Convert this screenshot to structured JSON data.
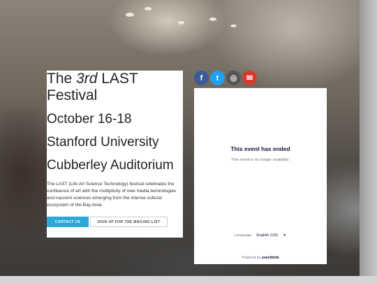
{
  "festival": {
    "title_prefix": "The ",
    "title_ordinal": "3rd",
    "title_suffix": " LAST",
    "title_line2": "Festival",
    "dates": "October 16-18",
    "venue_line1": "Stanford University",
    "venue_line2": "Cubberley Auditorium",
    "description": "The LAST (Life Art Science Technology) festival celebrates the confluence of art with the multiplicity of new media technologies and nascent sciences emerging from the intense cultural ecosystem of the Bay Area.",
    "contact_label": "CONTACT US",
    "signup_label": "SIGN UP FOR THE MAILING LIST"
  },
  "social": {
    "facebook_glyph": "f",
    "twitter_glyph": "t",
    "instagram_glyph": "◎",
    "mail_glyph": "✉",
    "colors": {
      "facebook": "#3b5b9a",
      "twitter": "#1da1f2",
      "instagram": "#555555",
      "mail": "#d63a2e"
    }
  },
  "eventbrite": {
    "heading": "This event has ended",
    "subtext": "This event is no longer available.",
    "language_label": "Language",
    "language_value": "English (US)",
    "powered_prefix": "Powered by ",
    "powered_brand": "eventbrite"
  },
  "theme": {
    "accent": "#2aa8d8",
    "eventbrite_ink": "#1e0a3c"
  }
}
